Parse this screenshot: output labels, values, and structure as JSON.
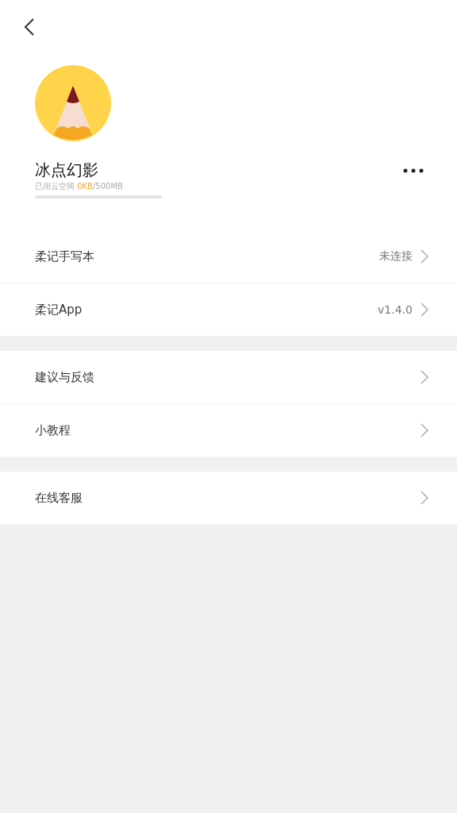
{
  "profile": {
    "name": "冰点幻影",
    "storage_label": "已用云空间",
    "storage_used": "0KB",
    "storage_total": "/500MB",
    "level": 0
  },
  "sections": [
    {
      "items": [
        {
          "label": "柔记手写本",
          "value": "未连接"
        },
        {
          "label": "柔记App",
          "value": "v1.4.0"
        }
      ]
    },
    {
      "items": [
        {
          "label": "建议与反馈"
        },
        {
          "label": "小教程"
        }
      ]
    },
    {
      "items": [
        {
          "label": "在线客服"
        }
      ]
    }
  ]
}
